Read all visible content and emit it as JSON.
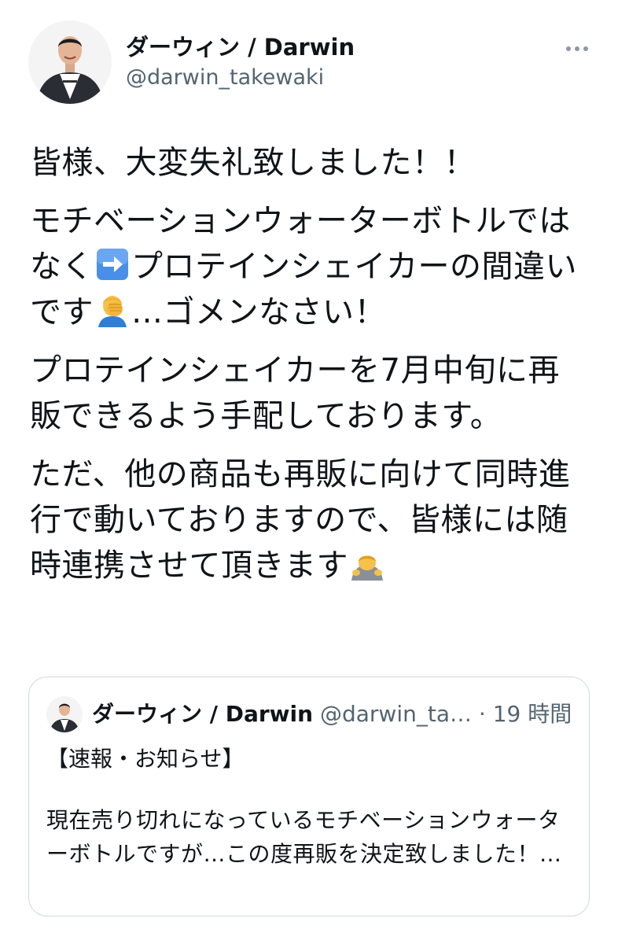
{
  "author": {
    "display_name": "ダーウィン / Darwin",
    "handle": "@darwin_takewaki"
  },
  "more_icon": "more-dots-icon",
  "tweet": {
    "p1": "皆様、大変失礼致しました！！",
    "p2_a": "モチベーションウォーターボトルではなく",
    "p2_b": "プロテインシェイカーの間違いです",
    "p2_c": "…ゴメンなさい！",
    "p3": "プロテインシェイカーを7月中旬に再販できるよう手配しております。",
    "p4": "ただ、他の商品も再販に向けて同時進行で動いておりますので、皆様には随時連携させて頂きます",
    "emojis": [
      "right-arrow-emoji",
      "facepalm-emoji",
      "bowing-emoji"
    ]
  },
  "quoted_tweet": {
    "display_name": "ダーウィン / Darwin",
    "handle": "@darwin_ta…",
    "separator": "·",
    "time": "19 時間",
    "label": "【速報・お知らせ】",
    "body": "現在売り切れになっているモチベーションウォーターボトルですが…この度再販を決定致しました！…"
  },
  "colors": {
    "text": "#0f1419",
    "secondary": "#536471",
    "border": "#cfd9de",
    "arrow_emoji_bg": "#4a8fe7"
  }
}
